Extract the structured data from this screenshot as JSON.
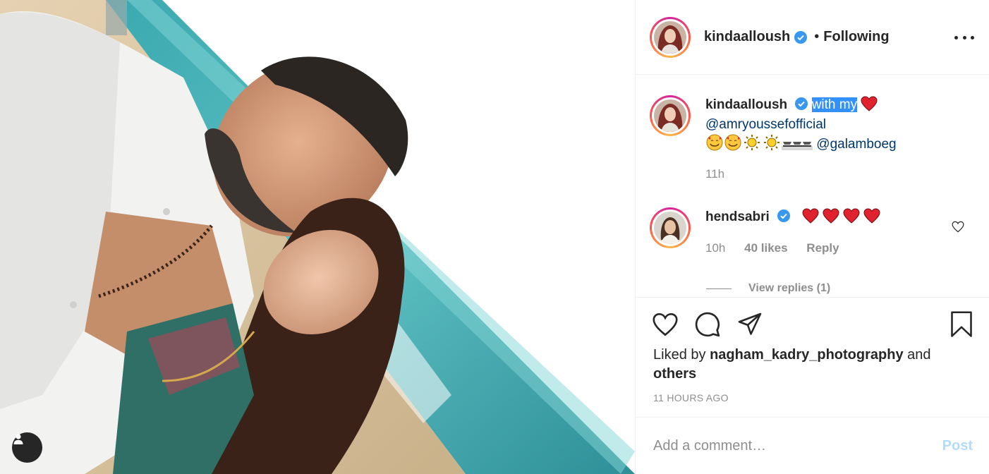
{
  "post": {
    "author": "kindaalloush",
    "separator": "•",
    "follow_status": "Following"
  },
  "caption": {
    "user": "kindaalloush",
    "text_highlighted": "with my",
    "mention1": "@amryoussefofficial",
    "mention2": "@galamboeg",
    "time": "11h"
  },
  "comment": {
    "user": "hendsabri",
    "time": "10h",
    "likes": "40 likes",
    "reply_label": "Reply",
    "view_replies": "View replies (1)"
  },
  "likes": {
    "prefix": "Liked by",
    "user": "nagham_kadry_photography",
    "and": "and",
    "others": "others"
  },
  "timestamp": "11 HOURS AGO",
  "add_comment": {
    "placeholder": "Add a comment…",
    "post_label": "Post"
  },
  "icons": {
    "verified": "verified-badge-icon",
    "more": "more-options-icon",
    "like": "heart-icon",
    "comment": "comment-icon",
    "share": "share-icon",
    "save": "bookmark-icon",
    "tag": "user-tag-icon"
  },
  "colors": {
    "verified_blue": "#3897f0",
    "heart_red": "#ed4956",
    "mention_blue": "#00376b",
    "post_disabled": "#b3dbff",
    "muted": "#8e8e8e"
  }
}
